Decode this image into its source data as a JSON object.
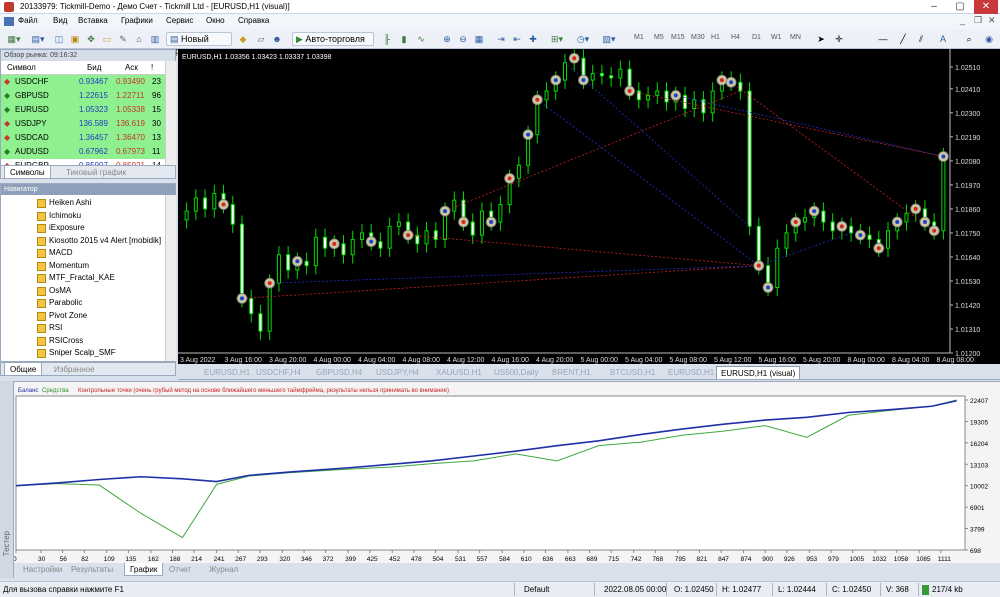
{
  "titlebar": {
    "title": "20133979: Tickmill-Demo - Демо Счет - Tickmill Ltd - [EURUSD,H1 (visual)]"
  },
  "menu": [
    "Файл",
    "Вид",
    "Вставка",
    "Графики",
    "Сервис",
    "Окно",
    "Справка"
  ],
  "toolbar": {
    "new_order": "Новый ордер",
    "auto_trading": "Авто-торговля",
    "timeframes": [
      "M1",
      "M5",
      "M15",
      "M30",
      "H1",
      "H4",
      "D1",
      "W1",
      "MN"
    ]
  },
  "market_watch": {
    "header": "Обзор рынка: 09:16:32",
    "columns": [
      "Символ",
      "Бид",
      "Аск",
      "!"
    ],
    "rows": [
      {
        "symbol": "USDCHF",
        "bid": "0.93467",
        "ask": "0.93490",
        "spread": "23",
        "dir": "down"
      },
      {
        "symbol": "GBPUSD",
        "bid": "1.22615",
        "ask": "1.22711",
        "spread": "96",
        "dir": "up"
      },
      {
        "symbol": "EURUSD",
        "bid": "1.05323",
        "ask": "1.05338",
        "spread": "15",
        "dir": "up"
      },
      {
        "symbol": "USDJPY",
        "bid": "136.589",
        "ask": "136.619",
        "spread": "30",
        "dir": "down"
      },
      {
        "symbol": "USDCAD",
        "bid": "1.36457",
        "ask": "1.36470",
        "spread": "13",
        "dir": "down"
      },
      {
        "symbol": "AUDUSD",
        "bid": "0.67962",
        "ask": "0.67973",
        "spread": "11",
        "dir": "up"
      },
      {
        "symbol": "EURGBP",
        "bid": "0.85907",
        "ask": "0.85921",
        "spread": "14",
        "dir": "down"
      }
    ],
    "tabs": [
      "Символы",
      "Тиковый график"
    ]
  },
  "navigator": {
    "header": "Навигатор",
    "items": [
      "Heiken Ashi",
      "Ichimoku",
      "iExposure",
      "Kiosotto 2015 v4 Alert [mobidik]",
      "MACD",
      "Momentum",
      "MTF_Fractal_KAE",
      "OsMA",
      "Parabolic",
      "Pivot Zone",
      "RSI",
      "RSICross",
      "Sniper Scalp_SMF"
    ],
    "tabs": [
      "Общие",
      "Избранное"
    ]
  },
  "chart": {
    "info": "EURUSD,H1  1.03356 1.03423 1.03337 1.03398",
    "y_ticks": [
      "1.02510",
      "1.02410",
      "1.02300",
      "1.02190",
      "1.02080",
      "1.01970",
      "1.01860",
      "1.01750",
      "1.01640",
      "1.01530",
      "1.01420",
      "1.01310",
      "1.01200"
    ],
    "x_ticks": [
      "3 Aug 2022",
      "3 Aug 16:00",
      "3 Aug 20:00",
      "4 Aug 00:00",
      "4 Aug 04:00",
      "4 Aug 08:00",
      "4 Aug 12:00",
      "4 Aug 16:00",
      "4 Aug 20:00",
      "5 Aug 00:00",
      "5 Aug 04:00",
      "5 Aug 08:00",
      "5 Aug 12:00",
      "5 Aug 16:00",
      "5 Aug 20:00",
      "8 Aug 00:00",
      "8 Aug 04:00",
      "8 Aug 08:00"
    ],
    "closes": [
      1.0185,
      1.0191,
      1.0186,
      1.0193,
      1.0188,
      1.0179,
      1.0145,
      1.0138,
      1.013,
      1.0152,
      1.0165,
      1.0158,
      1.0162,
      1.016,
      1.0173,
      1.0168,
      1.017,
      1.0165,
      1.0172,
      1.0175,
      1.0171,
      1.0168,
      1.0178,
      1.018,
      1.0174,
      1.017,
      1.0176,
      1.0172,
      1.0185,
      1.019,
      1.018,
      1.0174,
      1.0185,
      1.018,
      1.0188,
      1.02,
      1.0206,
      1.022,
      1.0236,
      1.024,
      1.0245,
      1.0253,
      1.0255,
      1.0245,
      1.0248,
      1.0247,
      1.0246,
      1.025,
      1.024,
      1.0236,
      1.0238,
      1.024,
      1.0235,
      1.0238,
      1.0232,
      1.0236,
      1.023,
      1.024,
      1.0245,
      1.0244,
      1.024,
      1.0178,
      1.016,
      1.015,
      1.0168,
      1.0175,
      1.018,
      1.0182,
      1.0185,
      1.018,
      1.0176,
      1.0178,
      1.0175,
      1.0174,
      1.0172,
      1.0168,
      1.0176,
      1.018,
      1.0184,
      1.0186,
      1.018,
      1.0176,
      1.021
    ]
  },
  "chart_tabs": [
    "3 Aug 2022",
    "EURUSD,H1",
    "USDCHF,H4",
    "GBPUSD,H4",
    "USDJPY,H4",
    "XAUUSD,H1",
    "US500,Daily",
    "BRENT,H1",
    "BTCUSD,H1",
    "EURUSD,H1",
    "EURUSD,H1 (visual)"
  ],
  "tester": {
    "legend_balance": "Баланс",
    "legend_equity": "Средства",
    "legend_note": "Контрольные точки (очень грубый метод на основе ближайшего меньшего таймфрейма, результаты нельзя принимать во внимание)",
    "y_ticks": [
      "22407",
      "19305",
      "16204",
      "13103",
      "10002",
      "6901",
      "3799",
      "698"
    ],
    "x_ticks": [
      "0",
      "30",
      "56",
      "82",
      "109",
      "135",
      "162",
      "188",
      "214",
      "241",
      "267",
      "293",
      "320",
      "346",
      "372",
      "399",
      "425",
      "452",
      "478",
      "504",
      "531",
      "557",
      "584",
      "610",
      "636",
      "663",
      "689",
      "715",
      "742",
      "768",
      "795",
      "821",
      "847",
      "874",
      "900",
      "926",
      "953",
      "979",
      "1005",
      "1032",
      "1058",
      "1085",
      "1111"
    ],
    "tabs": [
      "Настройки",
      "Результаты",
      "График",
      "Отчет",
      "Журнал"
    ],
    "side_label": "Тестер"
  },
  "chart_data": {
    "type": "line",
    "title": "",
    "x": [
      0,
      50,
      100,
      150,
      200,
      241,
      280,
      330,
      400,
      450,
      500,
      550,
      600,
      650,
      700,
      750,
      800,
      850,
      900,
      950,
      1000,
      1050,
      1100,
      1130
    ],
    "series": [
      {
        "name": "Баланс",
        "values": [
          10002,
          10400,
          10900,
          11300,
          11000,
          10600,
          11500,
          12000,
          12600,
          13100,
          13600,
          14300,
          15000,
          15800,
          16500,
          17400,
          18200,
          18900,
          19500,
          19900,
          20600,
          21000,
          21500,
          22300
        ]
      },
      {
        "name": "Средства",
        "values": [
          10002,
          10300,
          10100,
          6000,
          2500,
          10200,
          11400,
          11900,
          12400,
          12700,
          13200,
          13600,
          14600,
          13600,
          15800,
          16300,
          17300,
          17900,
          18700,
          17000,
          20200,
          20900,
          21500,
          22407
        ]
      }
    ],
    "ylim": [
      698,
      22407
    ],
    "colors": {
      "balance": "#1f2fa8",
      "equity": "#3fa83f"
    }
  },
  "status": {
    "help": "Для вызова справки нажмите F1",
    "profile": "Default",
    "datetime": "2022.08.05 00:00",
    "open": "O: 1.02450",
    "high": "H: 1.02477",
    "low": "L: 1.02444",
    "close": "C: 1.02450",
    "volume": "V: 368",
    "traffic": "217/4 kb"
  }
}
